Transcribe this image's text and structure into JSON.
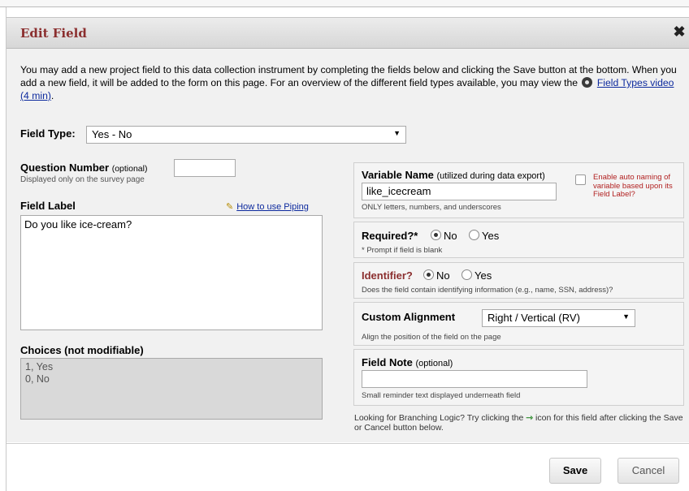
{
  "dialog": {
    "title": "Edit Field",
    "close_icon": "close-icon",
    "intro_text": "You may add a new project field to this data collection instrument by completing the fields below and clicking the Save button at the bottom. When you add a new field, it will be added to the form on this page. For an overview of the different field types available, you may view the",
    "video_icon": "film-reel-icon",
    "video_link": "Field Types video (4 min)",
    "intro_end": "."
  },
  "field_type": {
    "label": "Field Type:",
    "value": "Yes - No"
  },
  "question_number": {
    "label": "Question Number",
    "optional": "(optional)",
    "sub": "Displayed only on the survey page",
    "value": ""
  },
  "field_label": {
    "label": "Field Label",
    "piping_link": "How to use Piping",
    "piping_icon": "pencil-icon",
    "value": "Do you like ice-cream?"
  },
  "choices": {
    "label": "Choices (not modifiable)",
    "items": [
      "1, Yes",
      "0, No"
    ]
  },
  "variable_name": {
    "label": "Variable Name",
    "note": "(utilized during data export)",
    "value": "like_icecream",
    "sub": "ONLY letters, numbers, and underscores",
    "auto_naming": "Enable auto naming of variable based upon its Field Label?"
  },
  "required": {
    "label": "Required?*",
    "no": "No",
    "yes": "Yes",
    "selected": "No",
    "sub": "* Prompt if field is blank"
  },
  "identifier": {
    "label": "Identifier?",
    "no": "No",
    "yes": "Yes",
    "selected": "No",
    "sub": "Does the field contain identifying information (e.g., name, SSN, address)?"
  },
  "alignment": {
    "label": "Custom Alignment",
    "value": "Right / Vertical (RV)",
    "sub": "Align the position of the field on the page"
  },
  "field_note": {
    "label": "Field Note",
    "optional": "(optional)",
    "value": "",
    "sub": "Small reminder text displayed underneath field"
  },
  "branching": {
    "text_before": "Looking for Branching Logic? Try clicking the",
    "icon": "branching-funnel-icon",
    "text_after": "icon for this field after clicking the Save or Cancel button below."
  },
  "buttons": {
    "save": "Save",
    "cancel": "Cancel"
  }
}
